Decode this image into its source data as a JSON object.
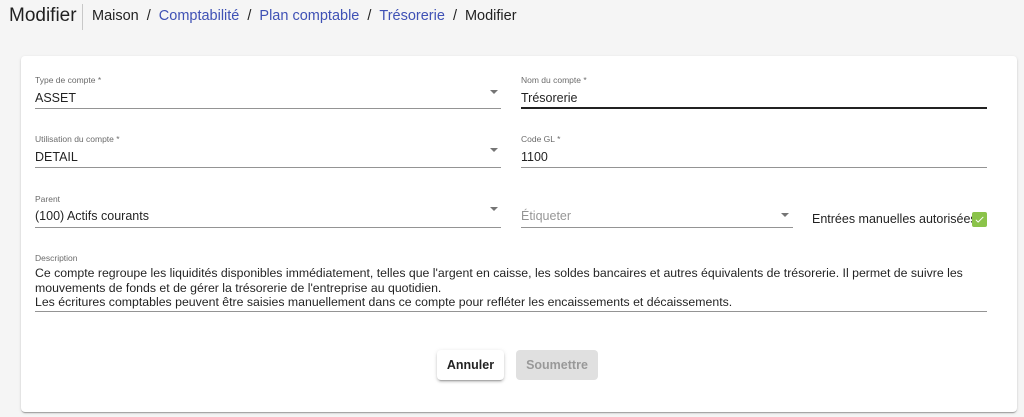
{
  "header": {
    "title": "Modifier",
    "breadcrumb": [
      {
        "label": "Maison",
        "link": false
      },
      {
        "label": "Comptabilité",
        "link": true
      },
      {
        "label": "Plan comptable",
        "link": true
      },
      {
        "label": "Trésorerie",
        "link": true
      },
      {
        "label": "Modifier",
        "link": false
      }
    ],
    "separator": "/"
  },
  "form": {
    "account_type": {
      "label": "Type de compte *",
      "value": "ASSET"
    },
    "account_name": {
      "label": "Nom du compte *",
      "value": "Trésorerie"
    },
    "account_usage": {
      "label": "Utilisation du compte *",
      "value": "DETAIL"
    },
    "gl_code": {
      "label": "Code GL *",
      "value": "1100"
    },
    "parent": {
      "label": "Parent",
      "value": "(100) Actifs courants"
    },
    "tag": {
      "placeholder": "Étiqueter"
    },
    "manual_entries": {
      "label": "Entrées manuelles autorisées",
      "checked": true
    },
    "description": {
      "label": "Description",
      "line1": "Ce compte regroupe les liquidités disponibles immédiatement, telles que l'argent en caisse, les soldes bancaires et autres équivalents de trésorerie. Il permet de suivre les mouvements de fonds et de gérer la trésorerie de l'entreprise au quotidien.",
      "line2": "Les écritures comptables peuvent être saisies manuellement dans ce compte pour refléter les encaissements et décaissements."
    }
  },
  "actions": {
    "cancel_label": "Annuler",
    "submit_label": "Soumettre"
  },
  "colors": {
    "link": "#3f51b5",
    "checkbox": "#8bc34a",
    "disabled_button": "#e0e0e0"
  }
}
